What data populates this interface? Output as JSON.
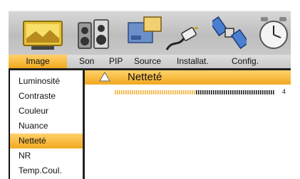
{
  "tabs": [
    {
      "label": "Image",
      "active": true
    },
    {
      "label": "Son",
      "active": false
    },
    {
      "label": "PIP",
      "active": false
    },
    {
      "label": "Source",
      "active": false
    },
    {
      "label": "Installat.",
      "active": false
    },
    {
      "label": "Config.",
      "active": false
    }
  ],
  "icons": [
    "tv-screen-icon",
    "speaker-icon",
    "pip-windows-icon",
    "plug-cable-icon",
    "satellite-icon",
    "clock-icon"
  ],
  "menu": {
    "items": [
      {
        "label": "Luminosité",
        "selected": false
      },
      {
        "label": "Contraste",
        "selected": false
      },
      {
        "label": "Couleur",
        "selected": false
      },
      {
        "label": "Nuance",
        "selected": false
      },
      {
        "label": "Netteté",
        "selected": true
      },
      {
        "label": "NR",
        "selected": false
      },
      {
        "label": "Temp.Coul.",
        "selected": false
      }
    ]
  },
  "detail": {
    "title": "Netteté",
    "value": "4",
    "level_fraction": 0.5
  },
  "colors": {
    "accent": "#f1a91f",
    "accent_light": "#ffd16a",
    "bar_dim": "#f2b13a",
    "bar_fill": "#222222",
    "separator": "#222222"
  }
}
